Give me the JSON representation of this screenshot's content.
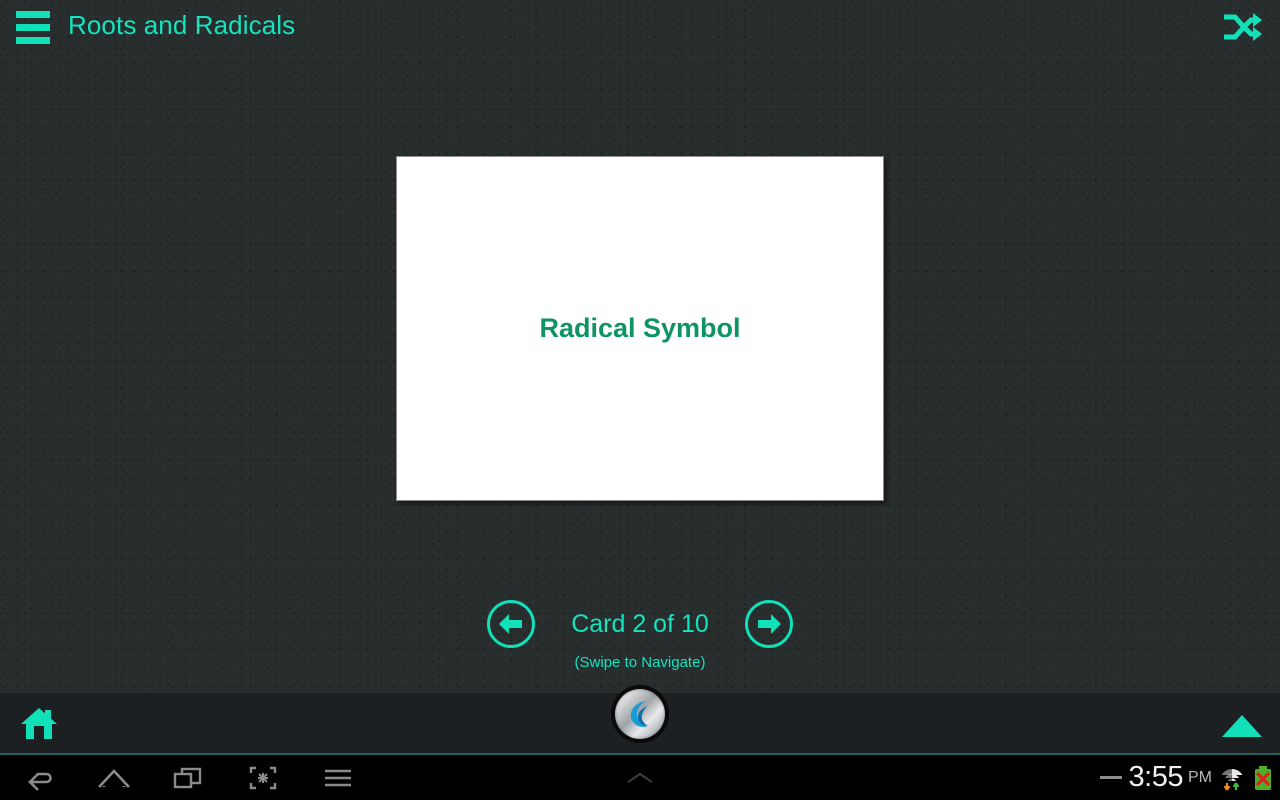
{
  "header": {
    "title": "Roots and Radicals",
    "menu_icon": "hamburger-menu-icon",
    "shuffle_icon": "shuffle-icon",
    "accent_color": "#14e3bc"
  },
  "card": {
    "text": "Radical Symbol",
    "text_color": "#0e9464",
    "background_color": "#ffffff",
    "border_color": "#8b8b8b"
  },
  "pager": {
    "prev_icon": "arrow-left-icon",
    "next_icon": "arrow-right-icon",
    "counter": "Card 2 of 10",
    "current_card": 2,
    "total_cards": 10,
    "hint": "(Swipe to Navigate)"
  },
  "app_bottom_bar": {
    "home_icon": "home-icon",
    "expand_icon": "triangle-up-icon",
    "background_color": "#1c2023"
  },
  "emulator": {
    "home_button_icon": "bluestacks-logo-icon"
  },
  "android_nav": {
    "items": [
      {
        "name": "back-icon"
      },
      {
        "name": "home-icon"
      },
      {
        "name": "recents-icon"
      },
      {
        "name": "shrink-icon"
      },
      {
        "name": "menu-icon"
      },
      {
        "name": "chevron-up-icon"
      }
    ],
    "status": {
      "dash_icon": "dash-icon",
      "time": "3:55",
      "ampm": "PM",
      "wifi_icon": "wifi-data-icon",
      "battery_icon": "battery-error-icon"
    }
  }
}
